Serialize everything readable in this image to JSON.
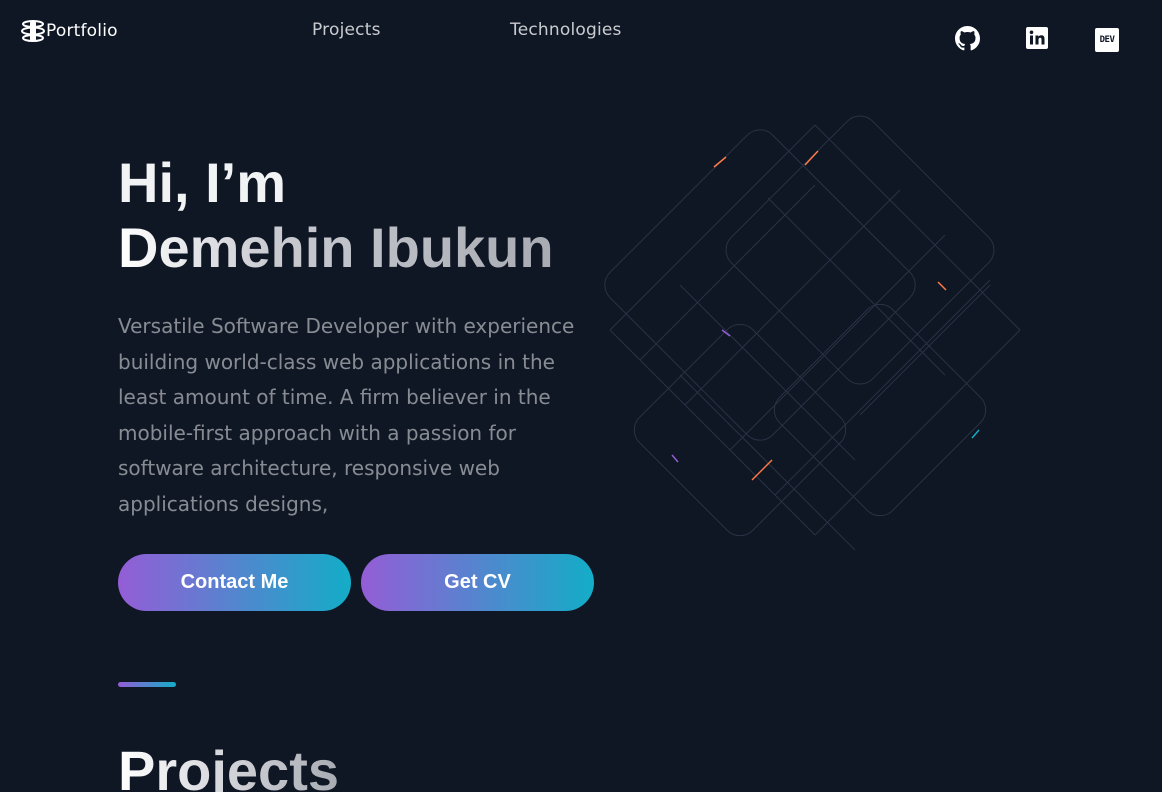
{
  "header": {
    "logo_text": "Portfolio",
    "nav": {
      "projects": "Projects",
      "technologies": "Technologies"
    },
    "social": {
      "github_icon": "github-icon",
      "linkedin_icon": "linkedin-icon",
      "dev_icon": "dev-icon",
      "dev_label": "DEV"
    }
  },
  "hero": {
    "greeting": "Hi, I’m",
    "name": "Demehin Ibukun",
    "description": "Versatile Software Developer with experience building world-class web applications in the least amount of time. A firm believer in the mobile-first approach with a passion for software architecture, responsive web applications designs,",
    "buttons": {
      "contact": "Contact Me",
      "cv": "Get CV"
    }
  },
  "section": {
    "title": "Projects"
  },
  "colors": {
    "background": "#0f1624",
    "gradient_start": "#945dd6",
    "gradient_mid": "#6978d1",
    "gradient_end": "#13adc7"
  }
}
